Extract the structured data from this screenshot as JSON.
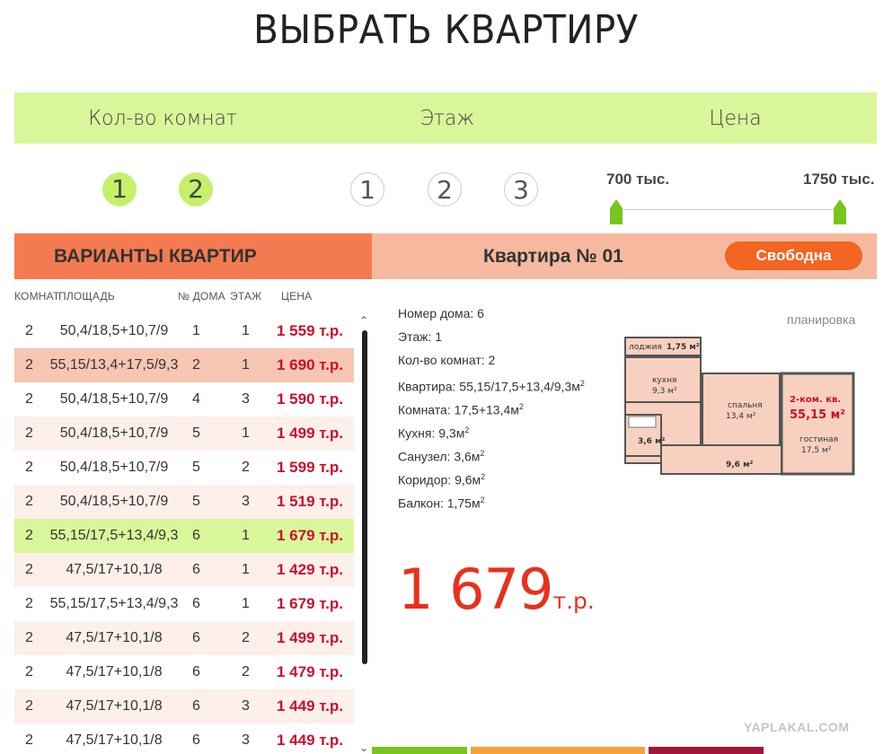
{
  "title": "ВЫБРАТЬ КВАРТИРУ",
  "filters": {
    "rooms_label": "Кол-во комнат",
    "floor_label": "Этаж",
    "price_label": "Цена",
    "rooms_options": [
      "1",
      "2"
    ],
    "floor_options": [
      "1",
      "2",
      "3"
    ],
    "price_min_label": "700 тыс.",
    "price_max_label": "1750 тыс.",
    "price_min": 700,
    "price_max": 1750
  },
  "list": {
    "header": "ВАРИАНТЫ КВАРТИР",
    "columns": [
      "КОМНАТ",
      "ПЛОЩАДЬ",
      "№ ДОМА",
      "ЭТАЖ",
      "ЦЕНА"
    ],
    "rows": [
      {
        "rooms": "2",
        "area": "50,4/18,5+10,7/9",
        "house": "1",
        "floor": "1",
        "price": "1 559 т.р.",
        "style": "plain"
      },
      {
        "rooms": "2",
        "area": "55,15/13,4+17,5/9,3",
        "house": "2",
        "floor": "1",
        "price": "1 690 т.р.",
        "style": "hl"
      },
      {
        "rooms": "2",
        "area": "50,4/18,5+10,7/9",
        "house": "4",
        "floor": "3",
        "price": "1 590 т.р.",
        "style": "plain"
      },
      {
        "rooms": "2",
        "area": "50,4/18,5+10,7/9",
        "house": "5",
        "floor": "1",
        "price": "1 499 т.р.",
        "style": "alt"
      },
      {
        "rooms": "2",
        "area": "50,4/18,5+10,7/9",
        "house": "5",
        "floor": "2",
        "price": "1 599 т.р.",
        "style": "plain"
      },
      {
        "rooms": "2",
        "area": "50,4/18,5+10,7/9",
        "house": "5",
        "floor": "3",
        "price": "1 519 т.р.",
        "style": "alt"
      },
      {
        "rooms": "2",
        "area": "55,15/17,5+13,4/9,3",
        "house": "6",
        "floor": "1",
        "price": "1 679 т.р.",
        "style": "sel"
      },
      {
        "rooms": "2",
        "area": "47,5/17+10,1/8",
        "house": "6",
        "floor": "1",
        "price": "1 429 т.р.",
        "style": "alt"
      },
      {
        "rooms": "2",
        "area": "55,15/17,5+13,4/9,3",
        "house": "6",
        "floor": "1",
        "price": "1 679 т.р.",
        "style": "plain"
      },
      {
        "rooms": "2",
        "area": "47,5/17+10,1/8",
        "house": "6",
        "floor": "2",
        "price": "1 499 т.р.",
        "style": "alt"
      },
      {
        "rooms": "2",
        "area": "47,5/17+10,1/8",
        "house": "6",
        "floor": "2",
        "price": "1 479 т.р.",
        "style": "plain"
      },
      {
        "rooms": "2",
        "area": "47,5/17+10,1/8",
        "house": "6",
        "floor": "3",
        "price": "1 449 т.р.",
        "style": "alt"
      },
      {
        "rooms": "2",
        "area": "47,5/17+10,1/8",
        "house": "6",
        "floor": "3",
        "price": "1 449 т.р.",
        "style": "plain"
      }
    ]
  },
  "detail": {
    "apartment_title": "Квартира № 01",
    "status": "Свободна",
    "info": [
      {
        "text": "Номер дома: 6",
        "sup": ""
      },
      {
        "text": "Этаж: 1",
        "sup": ""
      },
      {
        "text": "Кол-во комнат: 2",
        "sup": ""
      },
      {
        "text": "Квартира: 55,15/17,5+13,4/9,3м",
        "sup": "2"
      },
      {
        "text": "Комната: 17,5+13,4м",
        "sup": "2"
      },
      {
        "text": "Кухня: 9,3м",
        "sup": "2"
      },
      {
        "text": "Санузел: 3,6м",
        "sup": "2"
      },
      {
        "text": "Коридор: 9,6м",
        "sup": "2"
      },
      {
        "text": "Балкон: 1,75м",
        "sup": "2"
      }
    ],
    "plan_label": "планировка",
    "plan": {
      "loggia": "лоджия",
      "loggia_area": "1,75 м²",
      "kitchen": "кухня",
      "kitchen_area": "9,3 м²",
      "bedroom": "спальня",
      "bedroom_area": "13,4 м²",
      "type": "2-ком. кв.",
      "total_area": "55,15 м²",
      "living": "гостиная",
      "living_area": "17,5 м²",
      "bath_area": "3,6 м²",
      "hall_area": "9,6 м²"
    },
    "price_number": "1 679",
    "price_unit": "т.р."
  },
  "watermark": "YAPLAKAL.COM",
  "colors": {
    "filter_bg": "#d9f79a",
    "accent_orange": "#f47b51",
    "price_red": "#c8102e",
    "big_price": "#e8311c",
    "slider_green": "#7bc41e"
  }
}
